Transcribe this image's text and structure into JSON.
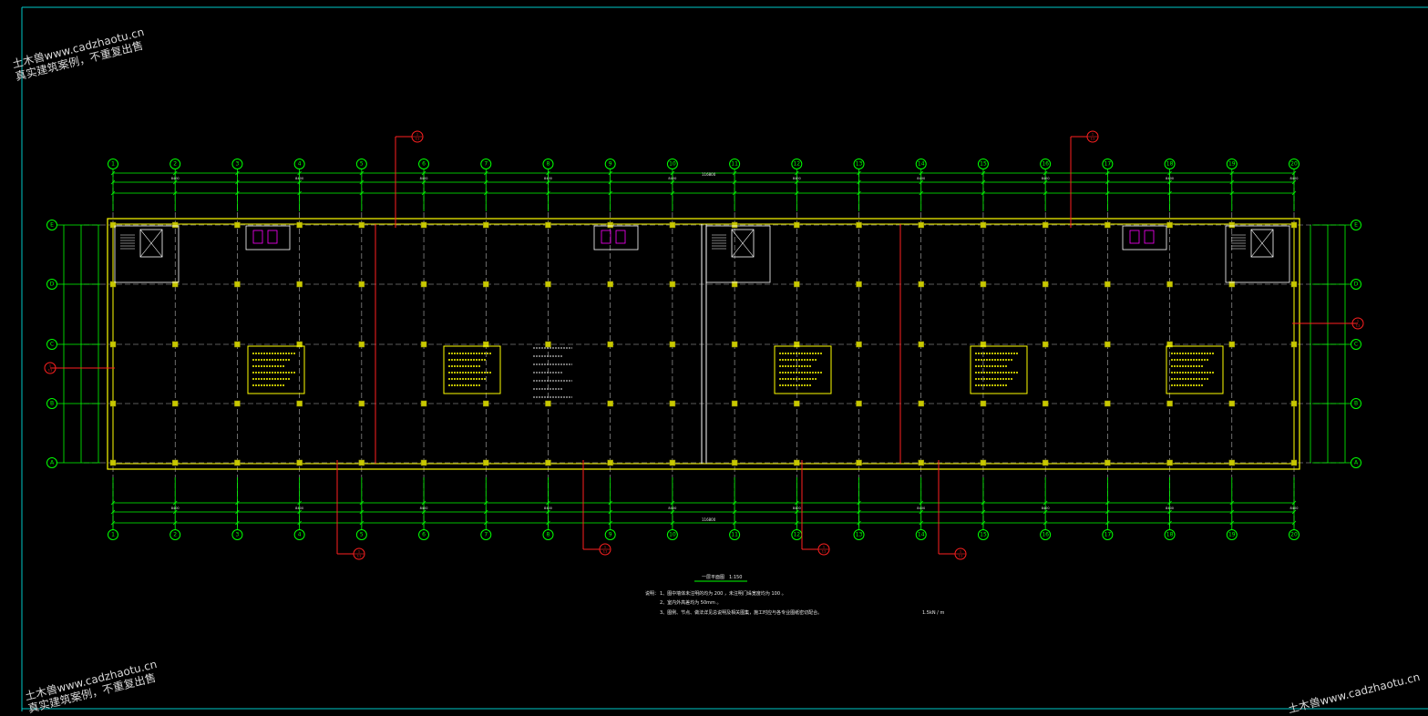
{
  "watermark": {
    "line1": "土木兽www.cadzhaotu.cn",
    "line2": "真实建筑案例，不重复出售"
  },
  "drawing": {
    "axis_numbers": [
      "1",
      "2",
      "3",
      "4",
      "5",
      "6",
      "7",
      "8",
      "9",
      "10",
      "11",
      "12",
      "13",
      "14",
      "15",
      "16",
      "17",
      "18",
      "19",
      "20"
    ],
    "axis_letters": [
      "E",
      "D",
      "C",
      "B",
      "A"
    ],
    "total_dim": "116800",
    "bay_dims": [
      "8400",
      "8400",
      "8400",
      "8400",
      "8400",
      "8400",
      "8400",
      "8400",
      "8400",
      "8400"
    ],
    "section_marks": [
      {
        "top": "1",
        "bottom": "11"
      },
      {
        "top": "1",
        "bottom": "11"
      },
      {
        "top": "1",
        "bottom": "11"
      },
      {
        "top": "1",
        "bottom": "11"
      },
      {
        "top": "1",
        "bottom": "11"
      },
      {
        "top": "1",
        "bottom": "11"
      },
      {
        "top": "1",
        "bottom": "11"
      },
      {
        "top": "1",
        "bottom": "11"
      }
    ],
    "plan_title": "一层平面图",
    "plan_scale": "1:150",
    "notes_label": "说明：",
    "notes": [
      "1、图中墙体未注明的均为 200 ，未注明门垛宽度均为 100 。",
      "2、室内外高差均为 50mm 。",
      "3、图例、节点、做法详见总说明及相关图集，施工时应与各专业图纸密切配合。"
    ],
    "notes_tail": "1.5kN / m",
    "colors": {
      "axis": "#00ff00",
      "wall": "#ffff00",
      "column": "#c8c800",
      "grid": "#b4b4b4",
      "section": "#ff2020",
      "stair": "#ffffff",
      "fixture": "#ff00ff",
      "text": "#e8e8e8",
      "frame": "#00c8c8"
    }
  }
}
